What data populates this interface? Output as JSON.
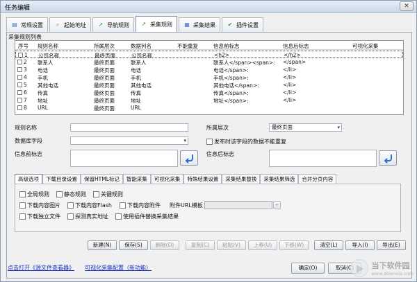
{
  "window": {
    "title": "任务编辑",
    "close_label": "✕"
  },
  "tabs": [
    {
      "label": "常规设置",
      "icon": "document-icon",
      "color": "#3b6fc4",
      "glyph": "▤"
    },
    {
      "label": "起始地址",
      "icon": "search-icon",
      "color": "#c06a1e",
      "glyph": "⌕"
    },
    {
      "label": "导航规则",
      "icon": "navigation-icon",
      "color": "#2f9a3d",
      "glyph": "➚"
    },
    {
      "label": "采集规则",
      "icon": "collect-rules-icon",
      "color": "#2f9a3d",
      "glyph": "➚"
    },
    {
      "label": "采集结果",
      "icon": "table-icon",
      "color": "#3b6fc4",
      "glyph": "▦"
    },
    {
      "label": "插件设置",
      "icon": "plugin-check-icon",
      "color": "#2f9a3d",
      "glyph": "✔"
    }
  ],
  "active_tab": 3,
  "rules_list": {
    "label": "采集规则列表",
    "columns": [
      "序号",
      "规则名称",
      "所属层次",
      "数据列名",
      "不能重复",
      "信息前标志",
      "信息后标志",
      "可视化采集"
    ],
    "rows": [
      {
        "num": "1",
        "name": "公司名称",
        "level": "最终页面",
        "column": "公司名称",
        "unique": "",
        "before": "<h2>",
        "after": "</h2>",
        "visual": ""
      },
      {
        "num": "2",
        "name": "联系人",
        "level": "最终页面",
        "column": "联系人",
        "unique": "",
        "before": "联系人</span><span>:",
        "after": "</span>",
        "visual": ""
      },
      {
        "num": "3",
        "name": "电话",
        "level": "最终页面",
        "column": "电话",
        "unique": "",
        "before": "电话</span>:",
        "after": "</li>",
        "visual": ""
      },
      {
        "num": "4",
        "name": "手机",
        "level": "最终页面",
        "column": "手机",
        "unique": "",
        "before": "手机</span>:",
        "after": "</li>",
        "visual": ""
      },
      {
        "num": "5",
        "name": "其他电话",
        "level": "最终页面",
        "column": "其他电话",
        "unique": "",
        "before": "其他电话</span>:",
        "after": "</li>",
        "visual": ""
      },
      {
        "num": "6",
        "name": "传真",
        "level": "最终页面",
        "column": "传真",
        "unique": "",
        "before": "传真</span>:",
        "after": "</li>",
        "visual": ""
      },
      {
        "num": "7",
        "name": "地址",
        "level": "最终页面",
        "column": "地址",
        "unique": "",
        "before": "地址</span>:",
        "after": "</li>",
        "visual": ""
      },
      {
        "num": "8",
        "name": "URL",
        "level": "最终页面",
        "column": "URL",
        "unique": "",
        "before": "",
        "after": "",
        "visual": ""
      }
    ]
  },
  "form": {
    "rule_name_label": "规则名称",
    "rule_name_value": "",
    "level_label": "所属层次",
    "level_value": "最终页面",
    "data_field_label": "数据库字段",
    "data_field_value": "",
    "no_repeat_label": "发布时该字段的数据不能重复",
    "before_label": "信息前标志",
    "after_label": "信息后标志"
  },
  "sub_tabs": [
    "高级选项",
    "下载目录设置",
    "保留HTML标记",
    "智能采集",
    "可视化采集",
    "特殊结果设置",
    "采集结果替换",
    "采集结果筛选",
    "合并分页内容"
  ],
  "active_sub_tab": 0,
  "advanced": {
    "row1": [
      "全局规则",
      "静态规则",
      "关键规则"
    ],
    "row2": [
      "下载内容图片",
      "下载内容Flash",
      "下载内容附件"
    ],
    "attach_label": "附件URL模板",
    "attach_value": "",
    "attach_btn": "+",
    "row3": [
      "下载独立文件",
      "探测真实地址",
      "使用插件替换采集结果"
    ]
  },
  "actions": {
    "new": "新建(N)",
    "save": "保存(S)",
    "delete": "删除(D)",
    "copy": "复制(C)",
    "paste": "粘贴(V)",
    "up": "上移(U)",
    "down": "下移(W)",
    "clear": "清空(L)",
    "import": "导入(I)",
    "export": "导出(E)",
    "ok": "确定(O)",
    "cancel": "取消(C)"
  },
  "links": {
    "open_viewer": "点击打开《源文件查看器》",
    "visual_config": "可视化采集配置（新功能）"
  },
  "watermark": {
    "line1": "当下软件园",
    "line2": "www.downxia.com"
  }
}
